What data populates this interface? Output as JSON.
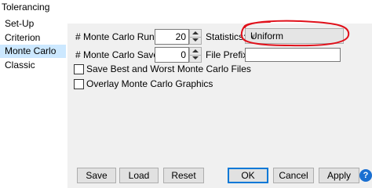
{
  "window": {
    "title": "Tolerancing"
  },
  "nav": {
    "items": [
      {
        "label": "Set-Up"
      },
      {
        "label": "Criterion"
      },
      {
        "label": "Monte Carlo",
        "selected": true
      },
      {
        "label": "Classic"
      }
    ]
  },
  "form": {
    "runs_label": "# Monte Carlo Runs:",
    "runs_value": "20",
    "statistics_label": "Statistics:",
    "statistics_value": "Uniform",
    "save_label": "# Monte Carlo Save:",
    "save_value": "0",
    "prefix_label": "File Prefix:",
    "prefix_value": "",
    "save_best_worst_label": "Save Best and Worst Monte Carlo Files",
    "overlay_label": "Overlay Monte Carlo Graphics"
  },
  "buttons": {
    "save": "Save",
    "load": "Load",
    "reset": "Reset",
    "ok": "OK",
    "cancel": "Cancel",
    "apply": "Apply",
    "help": "?"
  },
  "colors": {
    "selection": "#cce8ff",
    "annotation": "#e0101a",
    "help": "#1a6fd1"
  }
}
